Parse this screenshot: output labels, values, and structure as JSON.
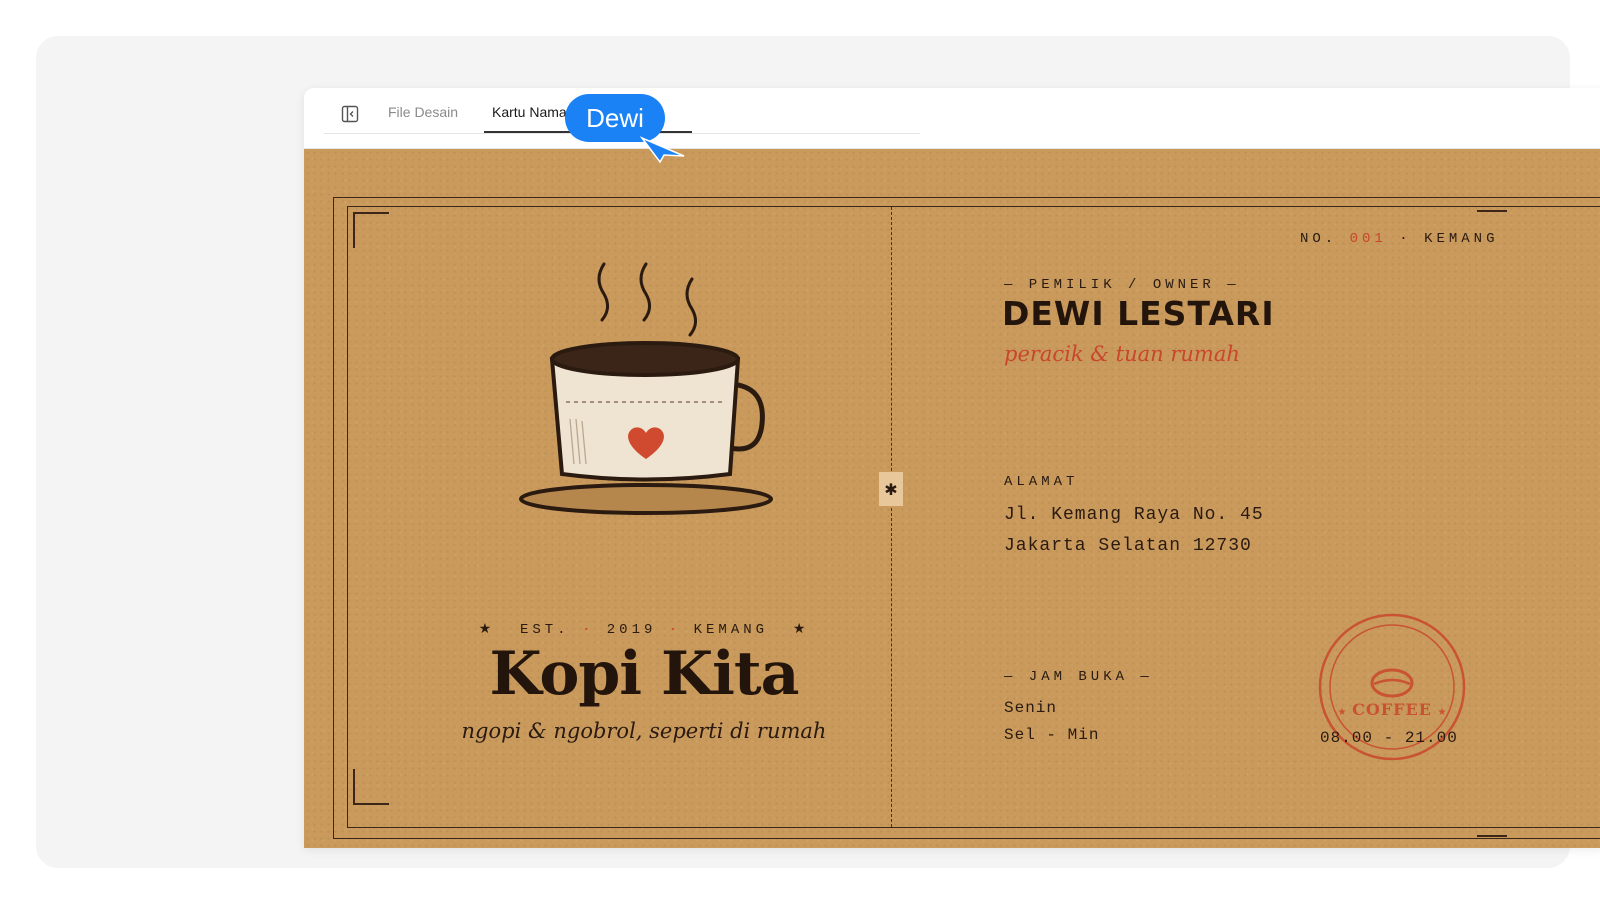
{
  "tabs": {
    "file_label": "File Desain",
    "active_label": "Kartu Nama Studio Caha..."
  },
  "collaborator": {
    "name": "Dewi",
    "color": "#1a82f5"
  },
  "card": {
    "left": {
      "est_prefix": "EST.",
      "est_year": "2019",
      "est_place": "KEMANG",
      "brand": "Kopi Kita",
      "tagline": "ngopi & ngobrol, seperti di rumah"
    },
    "right": {
      "number_prefix": "NO.",
      "number": "001",
      "number_place": "KEMANG",
      "owner_label": "— PEMILIK / OWNER —",
      "owner_name": "DEWI LESTARI",
      "owner_role": "peracik & tuan rumah",
      "address_label": "ALAMAT",
      "address_line1": "Jl. Kemang Raya No. 45",
      "address_line2": "Jakarta Selatan 12730",
      "hours_label": "— JAM BUKA —",
      "hours_day1": "Senin",
      "hours_day2": "Sel - Min",
      "hours_time": "08.00 - 21.00",
      "stamp_text": "COFFEE"
    },
    "colors": {
      "paper": "#c99a5c",
      "ink": "#24150c",
      "accent": "#c9462c"
    }
  }
}
